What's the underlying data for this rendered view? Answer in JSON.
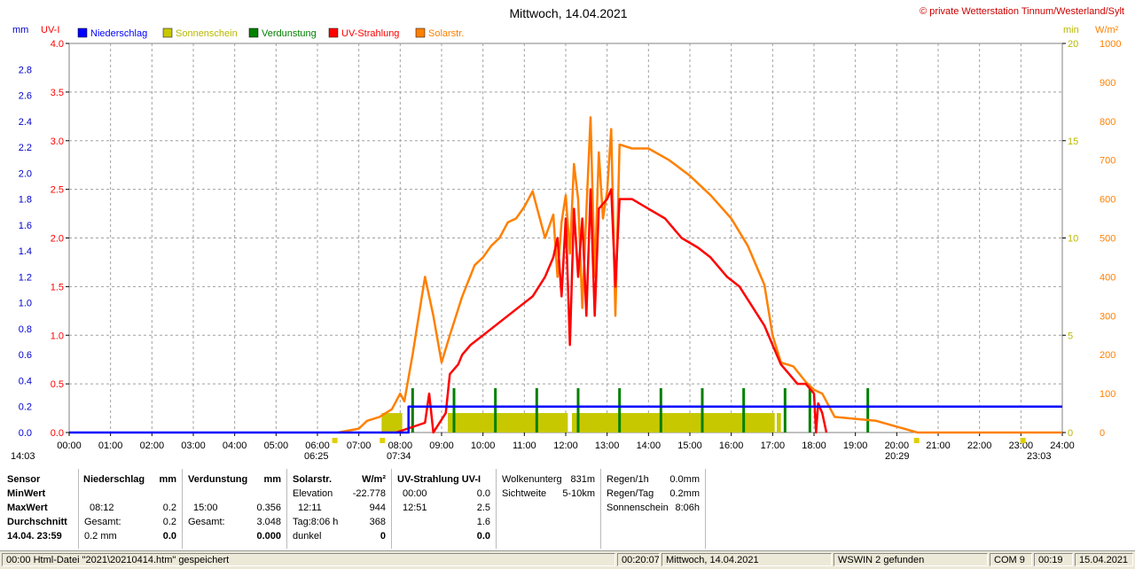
{
  "header": {
    "title": "Mittwoch, 14.04.2021",
    "copyright": "© private Wetterstation Tinnum/Westerland/Sylt",
    "unit_mm": "mm",
    "unit_uvi": "UV-I",
    "unit_min": "min",
    "unit_wm2": "W/m²"
  },
  "legend": [
    {
      "label": "Niederschlag",
      "color": "#0000ff"
    },
    {
      "label": "Sonnenschein",
      "color": "#c8c800"
    },
    {
      "label": "Verdunstung",
      "color": "#008000"
    },
    {
      "label": "UV-Strahlung",
      "color": "#ff0000"
    },
    {
      "label": "Solarstr.",
      "color": "#ff8000"
    }
  ],
  "markers": {
    "left": "14:03",
    "sunrise": "06:25",
    "first_sun": "07:34",
    "sunset": "20:29",
    "right": "23:03"
  },
  "chart_data": {
    "type": "line",
    "x_ticks": [
      "00:00",
      "01:00",
      "02:00",
      "03:00",
      "04:00",
      "05:00",
      "06:00",
      "07:00",
      "08:00",
      "09:00",
      "10:00",
      "11:00",
      "12:00",
      "13:00",
      "14:00",
      "15:00",
      "16:00",
      "17:00",
      "18:00",
      "19:00",
      "20:00",
      "21:00",
      "22:00",
      "23:00",
      "24:00"
    ],
    "axes": {
      "mm": {
        "range": [
          0,
          3.0
        ],
        "ticks": [
          "0.0",
          "0.2",
          "0.4",
          "0.6",
          "0.8",
          "1.0",
          "1.2",
          "1.4",
          "1.6",
          "1.8",
          "2.0",
          "2.2",
          "2.4",
          "2.6",
          "2.8"
        ]
      },
      "uvi": {
        "range": [
          0,
          4.0
        ],
        "ticks": [
          "0.0",
          "0.5",
          "1.0",
          "1.5",
          "2.0",
          "2.5",
          "3.0",
          "3.5",
          "4.0"
        ]
      },
      "min": {
        "range": [
          0,
          20
        ],
        "ticks": [
          "0",
          "5",
          "10",
          "15",
          "20"
        ]
      },
      "wm2": {
        "range": [
          0,
          1000
        ],
        "ticks": [
          "0",
          "100",
          "200",
          "300",
          "400",
          "500",
          "600",
          "700",
          "800",
          "900",
          "1000"
        ]
      }
    },
    "series": [
      {
        "name": "Niederschlag",
        "unit": "mm",
        "color": "#0000ff",
        "points": [
          [
            0,
            0
          ],
          [
            8.2,
            0
          ],
          [
            8.2,
            0.2
          ],
          [
            24,
            0.2
          ]
        ]
      },
      {
        "name": "UV-Strahlung",
        "unit": "UV-I",
        "color": "#ff0000",
        "points": [
          [
            7.9,
            0
          ],
          [
            8.6,
            0.1
          ],
          [
            8.7,
            0.4
          ],
          [
            8.8,
            0
          ],
          [
            9.1,
            0.2
          ],
          [
            9.2,
            0.6
          ],
          [
            9.4,
            0.7
          ],
          [
            9.5,
            0.8
          ],
          [
            9.7,
            0.9
          ],
          [
            10.0,
            1.0
          ],
          [
            10.3,
            1.1
          ],
          [
            10.6,
            1.2
          ],
          [
            10.9,
            1.3
          ],
          [
            11.2,
            1.4
          ],
          [
            11.5,
            1.6
          ],
          [
            11.7,
            1.8
          ],
          [
            11.8,
            2.0
          ],
          [
            11.9,
            1.4
          ],
          [
            12.0,
            2.2
          ],
          [
            12.1,
            0.9
          ],
          [
            12.2,
            2.3
          ],
          [
            12.3,
            1.6
          ],
          [
            12.4,
            2.2
          ],
          [
            12.5,
            1.2
          ],
          [
            12.6,
            2.5
          ],
          [
            12.7,
            1.2
          ],
          [
            12.8,
            2.3
          ],
          [
            13.0,
            2.4
          ],
          [
            13.1,
            2.5
          ],
          [
            13.2,
            1.5
          ],
          [
            13.3,
            2.4
          ],
          [
            13.6,
            2.4
          ],
          [
            14.0,
            2.3
          ],
          [
            14.4,
            2.2
          ],
          [
            14.8,
            2.0
          ],
          [
            15.2,
            1.9
          ],
          [
            15.5,
            1.8
          ],
          [
            15.9,
            1.6
          ],
          [
            16.2,
            1.5
          ],
          [
            16.5,
            1.3
          ],
          [
            16.8,
            1.1
          ],
          [
            17.0,
            0.9
          ],
          [
            17.2,
            0.7
          ],
          [
            17.4,
            0.6
          ],
          [
            17.6,
            0.5
          ],
          [
            17.8,
            0.5
          ],
          [
            18.0,
            0.4
          ],
          [
            18.05,
            0
          ],
          [
            18.1,
            0.3
          ],
          [
            18.2,
            0.2
          ],
          [
            18.3,
            0
          ]
        ]
      },
      {
        "name": "Solarstr.",
        "unit": "W/m²",
        "color": "#ff8000",
        "points": [
          [
            6.5,
            0
          ],
          [
            7.0,
            10
          ],
          [
            7.2,
            30
          ],
          [
            7.5,
            40
          ],
          [
            7.8,
            60
          ],
          [
            8.0,
            100
          ],
          [
            8.1,
            80
          ],
          [
            8.3,
            200
          ],
          [
            8.6,
            400
          ],
          [
            8.8,
            300
          ],
          [
            9.0,
            180
          ],
          [
            9.2,
            250
          ],
          [
            9.5,
            350
          ],
          [
            9.8,
            430
          ],
          [
            10.0,
            450
          ],
          [
            10.2,
            480
          ],
          [
            10.4,
            500
          ],
          [
            10.6,
            540
          ],
          [
            10.8,
            550
          ],
          [
            11.0,
            580
          ],
          [
            11.2,
            620
          ],
          [
            11.3,
            580
          ],
          [
            11.5,
            500
          ],
          [
            11.7,
            560
          ],
          [
            11.8,
            400
          ],
          [
            11.9,
            540
          ],
          [
            12.0,
            610
          ],
          [
            12.1,
            460
          ],
          [
            12.2,
            690
          ],
          [
            12.3,
            600
          ],
          [
            12.4,
            320
          ],
          [
            12.5,
            570
          ],
          [
            12.6,
            810
          ],
          [
            12.7,
            400
          ],
          [
            12.8,
            720
          ],
          [
            12.9,
            550
          ],
          [
            13.0,
            620
          ],
          [
            13.1,
            780
          ],
          [
            13.2,
            300
          ],
          [
            13.3,
            740
          ],
          [
            13.6,
            730
          ],
          [
            14.0,
            730
          ],
          [
            14.5,
            700
          ],
          [
            15.0,
            660
          ],
          [
            15.5,
            610
          ],
          [
            16.0,
            550
          ],
          [
            16.4,
            480
          ],
          [
            16.8,
            380
          ],
          [
            17.0,
            250
          ],
          [
            17.2,
            180
          ],
          [
            17.5,
            170
          ],
          [
            17.8,
            130
          ],
          [
            18.0,
            110
          ],
          [
            18.2,
            100
          ],
          [
            18.5,
            40
          ],
          [
            19.0,
            35
          ],
          [
            19.5,
            30
          ],
          [
            20.0,
            15
          ],
          [
            20.5,
            0
          ],
          [
            24,
            0
          ]
        ]
      },
      {
        "name": "Sonnenschein",
        "unit": "min",
        "color": "#c8c800",
        "bars": [
          [
            7.55,
            8.05,
            1.0
          ],
          [
            9.15,
            12.05,
            1.0
          ],
          [
            12.15,
            17.05,
            1.0
          ],
          [
            17.1,
            17.2,
            1.0
          ]
        ]
      },
      {
        "name": "Verdunstung",
        "unit": "mm",
        "color": "#008000",
        "ticks": [
          8.3,
          9.3,
          10.3,
          11.3,
          12.3,
          13.3,
          14.3,
          15.3,
          16.3,
          17.3,
          17.9,
          19.3
        ]
      }
    ]
  },
  "panels": {
    "sensor": {
      "h": "Sensor",
      "min": "MinWert",
      "max": "MaxWert",
      "avg": "Durchschnitt",
      "date": "14.04. 23:59"
    },
    "rain": {
      "h": "Niederschlag",
      "u": "mm",
      "max_t": "08:12",
      "max_v": "0.2",
      "total_l": "Gesamt:",
      "total_v": "0.2",
      "avg_l": "0.2 mm",
      "avg_v": "0.0"
    },
    "evap": {
      "h": "Verdunstung",
      "u": "mm",
      "max_t": "15:00",
      "max_v": "0.356",
      "total_l": "Gesamt:",
      "total_v": "3.048",
      "avg_v": "0.000"
    },
    "solar": {
      "h": "Solarstr.",
      "u": "W/m²",
      "elev_l": "Elevation",
      "elev_v": "-22.778",
      "max_t": "12:11",
      "max_v": "944",
      "day_l": "Tag:8:06 h",
      "day_v": "368",
      "dark_l": "dunkel",
      "dark_v": "0"
    },
    "uv": {
      "h": "UV-Strahlung UV-I",
      "min_t": "00:00",
      "min_v": "0.0",
      "max_t": "12:51",
      "max_v": "2.5",
      "avg_v": "1.6",
      "avg2_v": "0.0"
    },
    "clouds": {
      "cb_l": "Wolkenunterg",
      "cb_v": "831m",
      "vis_l": "Sichtweite",
      "vis_v": "5-10km"
    },
    "rainrate": {
      "r1_l": "Regen/1h",
      "r1_v": "0.0mm",
      "rd_l": "Regen/Tag",
      "rd_v": "0.2mm",
      "sun_l": "Sonnenschein",
      "sun_v": "8:06h"
    }
  },
  "statusbar": {
    "file": "00:00  Html-Datei  \"2021\\20210414.htm\"  gespeichert",
    "time": "00:20:07",
    "date": "Mittwoch, 14.04.2021",
    "wswin": "WSWIN 2 gefunden",
    "com": "COM 9",
    "clock": "00:19",
    "date2": "15.04.2021"
  }
}
